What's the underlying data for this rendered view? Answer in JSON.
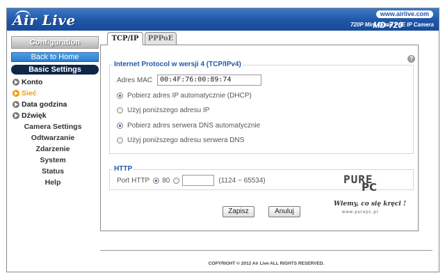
{
  "header": {
    "logo": "Air Live",
    "site_url": "www.airlive.com",
    "model": "MD-720",
    "model_desc": "720P Mini Dome PoE IP Camera"
  },
  "sidebar": {
    "configuration": "Configuration",
    "back_home": "Back to Home",
    "basic_settings": "Basic Settings",
    "basic_items": [
      {
        "label": "Konto"
      },
      {
        "label": "Sieć"
      },
      {
        "label": "Data godzina"
      },
      {
        "label": "Dźwięk"
      }
    ],
    "sections": [
      {
        "label": "Camera Settings"
      },
      {
        "label": "Odtwarzanie"
      },
      {
        "label": "Zdarzenie"
      },
      {
        "label": "System"
      },
      {
        "label": "Status"
      },
      {
        "label": "Help"
      }
    ]
  },
  "tabs": [
    {
      "label": "TCP/IP"
    },
    {
      "label": "PPPoE"
    }
  ],
  "ipv4": {
    "legend": "Internet Protocol w wersji 4 (TCP/IPv4)",
    "mac_label": "Adres MAC",
    "mac_value": "00:4F:76:00:89:74",
    "options": [
      {
        "label": "Pobierz adres IP automatycznie (DHCP)",
        "selected": true
      },
      {
        "label": "Użyj poniższego adresu IP",
        "selected": false
      },
      {
        "label": "Pobierz adres serwera DNS automatycznie",
        "selected": true
      },
      {
        "label": "Użyj poniższego adresu serwera DNS",
        "selected": false
      }
    ]
  },
  "http": {
    "legend": "HTTP",
    "port_label": "Port HTTP",
    "port_default": "80",
    "port_range": "(1124 ~ 65534)"
  },
  "buttons": {
    "save": "Zapisz",
    "cancel": "Anuluj"
  },
  "watermark": {
    "pure": "PURE",
    "pc": "PC",
    "slogan": "Wiemy, co się kręci !",
    "url": "www.purepc.pl"
  },
  "footer": {
    "copyright": "COPYRIGHT © 2012 Air Live ALL RIGHTS RESERVED."
  }
}
